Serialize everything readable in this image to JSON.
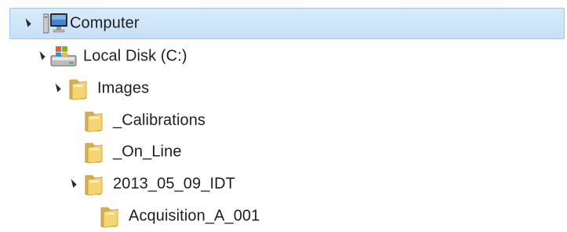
{
  "tree": {
    "items": [
      {
        "label": "Computer",
        "icon": "computer-icon",
        "expanded": true,
        "selected": true
      },
      {
        "label": "Local Disk (C:)",
        "icon": "drive-icon",
        "expanded": true
      },
      {
        "label": "Images",
        "icon": "folder-icon",
        "expanded": true
      },
      {
        "label": "_Calibrations",
        "icon": "folder-icon"
      },
      {
        "label": "_On_Line",
        "icon": "folder-icon"
      },
      {
        "label": "2013_05_09_IDT",
        "icon": "folder-icon",
        "expanded": true
      },
      {
        "label": "Acquisition_A_001",
        "icon": "folder-icon"
      }
    ]
  },
  "colors": {
    "selection_fill": "#cfe5f8",
    "selection_border": "#9fc7ee",
    "folder_yellow": "#f2cc5e",
    "text": "#1e1e1e"
  }
}
